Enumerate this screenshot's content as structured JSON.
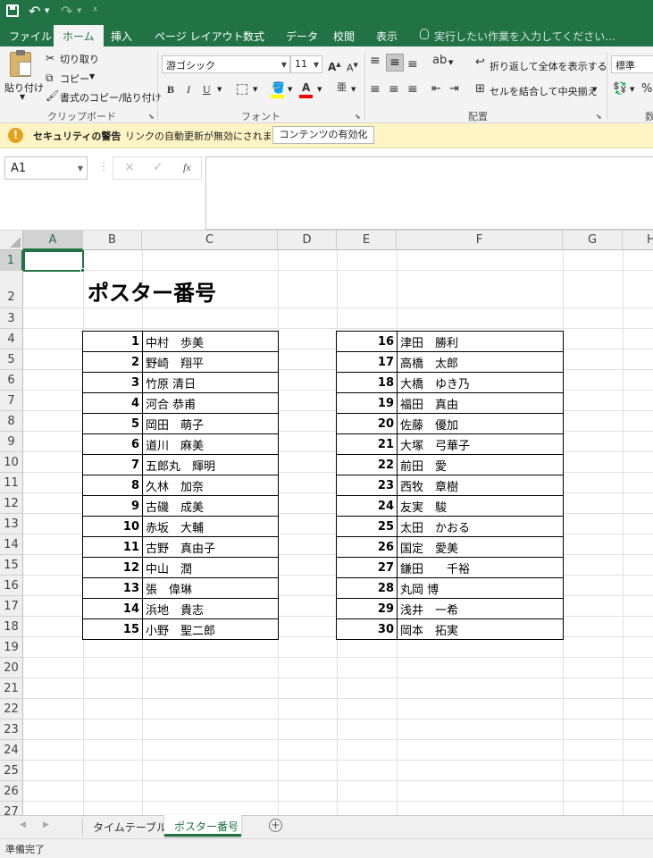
{
  "qat": {
    "save_icon": "save-icon",
    "undo_icon": "undo-icon",
    "redo_icon": "redo-icon",
    "customize_icon": "customize-qat-icon"
  },
  "tabs": [
    "ファイル",
    "ホーム",
    "挿入",
    "ページ レイアウト",
    "数式",
    "データ",
    "校閲",
    "表示"
  ],
  "tell_me": "実行したい作業を入力してください...",
  "ribbon": {
    "paste": "貼り付け",
    "cut": "切り取り",
    "copy": "コピー",
    "format_painter": "書式のコピー/貼り付け",
    "clipboard_group": "クリップボード",
    "font_name": "游ゴシック",
    "font_size": "11",
    "bold": "B",
    "italic": "I",
    "underline": "U",
    "font_color_letter": "A",
    "highlight_color": "#ffff00",
    "font_color": "#ff0000",
    "font_group": "フォント",
    "wrap_text": "折り返して全体を表示する",
    "merge_center": "セルを結合して中央揃え",
    "alignment_group": "配置",
    "number_format": "標準",
    "percent": "%",
    "number_group_partial": "数"
  },
  "security": {
    "title": "セキュリティの警告",
    "message": "リンクの自動更新が無効にされました",
    "button": "コンテンツの有効化"
  },
  "formula_bar": {
    "name_box": "A1",
    "cancel": "×",
    "enter": "✓",
    "fx": "fx",
    "content": ""
  },
  "columns": [
    "A",
    "B",
    "C",
    "D",
    "E",
    "F",
    "G",
    "H"
  ],
  "rows": [
    "1",
    "2",
    "3",
    "4",
    "5",
    "6",
    "7",
    "8",
    "9",
    "10",
    "11",
    "12",
    "13",
    "14",
    "15",
    "16",
    "17",
    "18",
    "19",
    "20",
    "21",
    "22",
    "23",
    "24",
    "25",
    "26",
    "27"
  ],
  "sheet_title": "ポスター番号",
  "left_table": [
    {
      "no": "1",
      "name": "中村　歩美"
    },
    {
      "no": "2",
      "name": "野崎　翔平"
    },
    {
      "no": "3",
      "name": "竹原 清日"
    },
    {
      "no": "4",
      "name": "河合 恭甫"
    },
    {
      "no": "5",
      "name": "岡田　萌子"
    },
    {
      "no": "6",
      "name": "道川　麻美"
    },
    {
      "no": "7",
      "name": "五郎丸　輝明"
    },
    {
      "no": "8",
      "name": "久林　加奈"
    },
    {
      "no": "9",
      "name": "古磯　成美"
    },
    {
      "no": "10",
      "name": "赤坂　大輔"
    },
    {
      "no": "11",
      "name": "古野　真由子"
    },
    {
      "no": "12",
      "name": "中山　潤"
    },
    {
      "no": "13",
      "name": "張　偉琳"
    },
    {
      "no": "14",
      "name": "浜地　貴志"
    },
    {
      "no": "15",
      "name": "小野　聖二郎"
    }
  ],
  "right_table": [
    {
      "no": "16",
      "name": "津田　勝利"
    },
    {
      "no": "17",
      "name": "高橋　太郎"
    },
    {
      "no": "18",
      "name": "大橋　ゆき乃"
    },
    {
      "no": "19",
      "name": "福田　真由"
    },
    {
      "no": "20",
      "name": "佐藤　優加"
    },
    {
      "no": "21",
      "name": "大塚　弓華子"
    },
    {
      "no": "22",
      "name": "前田　愛"
    },
    {
      "no": "23",
      "name": "西牧　章樹"
    },
    {
      "no": "24",
      "name": "友実　駿"
    },
    {
      "no": "25",
      "name": "太田　かおる"
    },
    {
      "no": "26",
      "name": "国定　愛美"
    },
    {
      "no": "27",
      "name": "鎌田　　千裕"
    },
    {
      "no": "28",
      "name": "丸岡 博"
    },
    {
      "no": "29",
      "name": "浅井　一希"
    },
    {
      "no": "30",
      "name": "岡本　拓実"
    }
  ],
  "sheet_tabs": [
    "タイムテーブル",
    "ポスター番号"
  ],
  "add_sheet": "+",
  "status": "準備完了",
  "accent_color": "#217346"
}
